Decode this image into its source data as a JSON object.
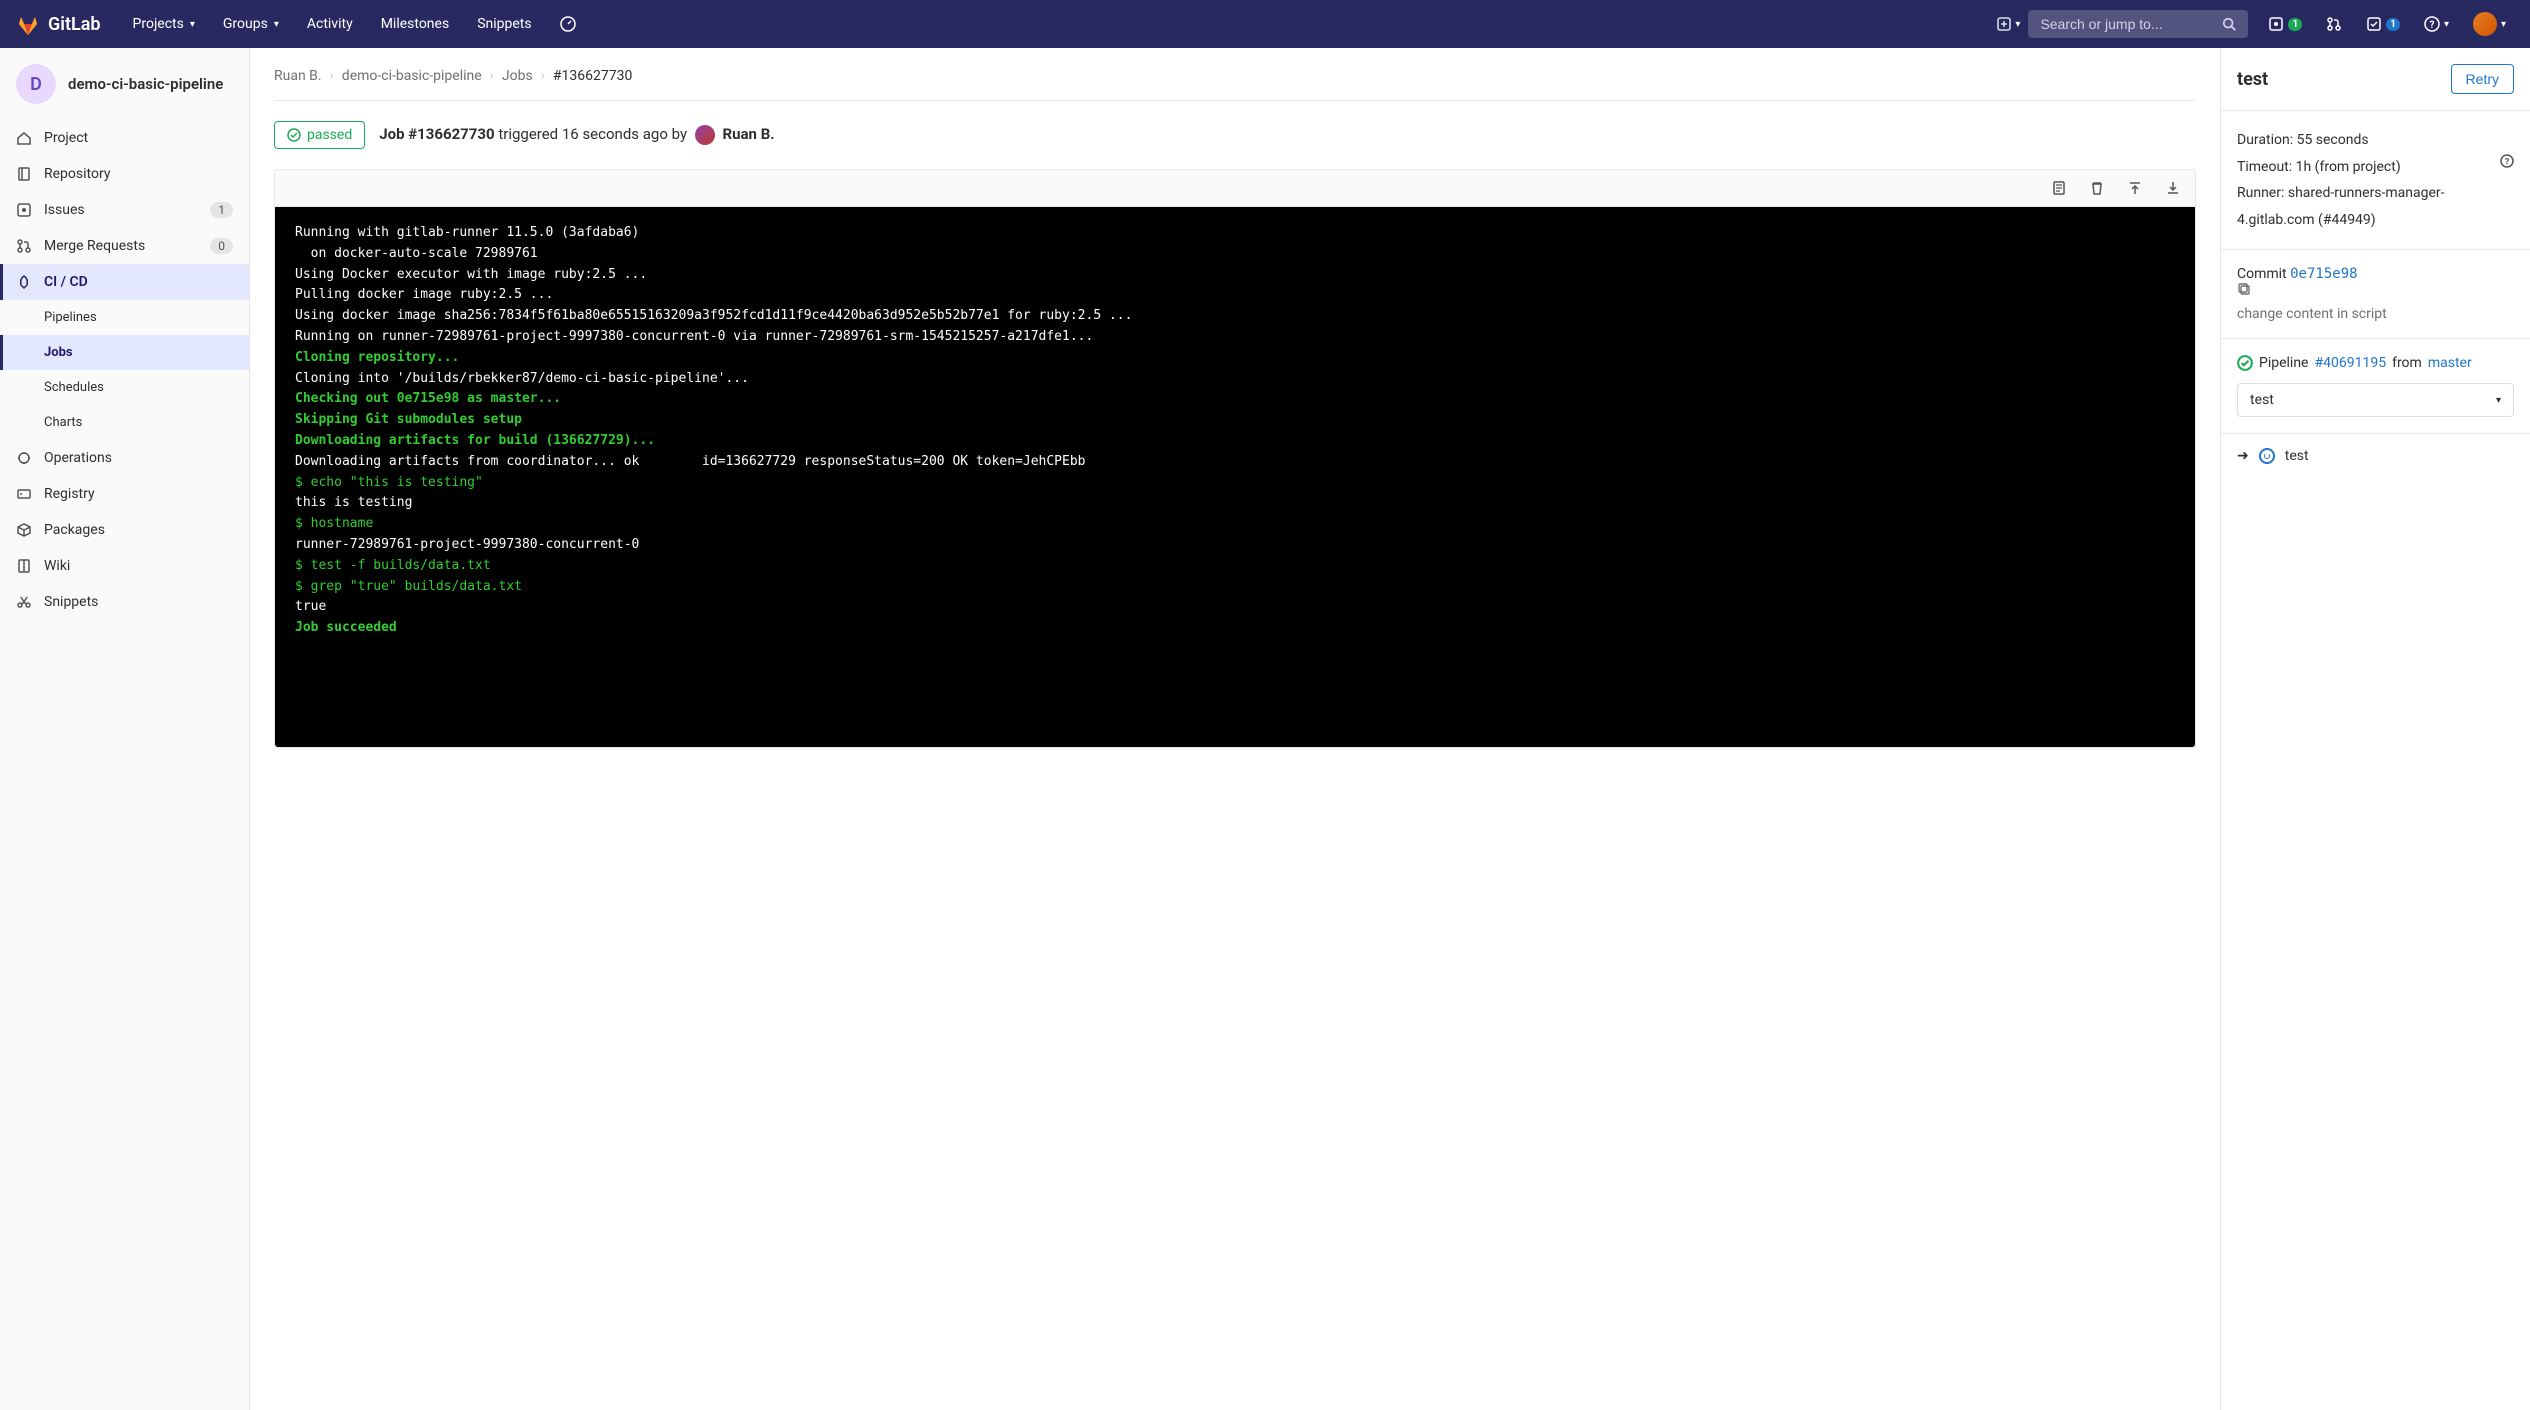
{
  "topnav": {
    "brand": "GitLab",
    "items": [
      "Projects",
      "Groups",
      "Activity",
      "Milestones",
      "Snippets"
    ],
    "search_placeholder": "Search or jump to...",
    "issues_badge": "1",
    "todos_badge": "1"
  },
  "sidebar": {
    "project_initial": "D",
    "project_name": "demo-ci-basic-pipeline",
    "items": [
      {
        "icon": "home",
        "label": "Project"
      },
      {
        "icon": "repo",
        "label": "Repository"
      },
      {
        "icon": "issues",
        "label": "Issues",
        "count": "1"
      },
      {
        "icon": "mr",
        "label": "Merge Requests",
        "count": "0"
      },
      {
        "icon": "rocket",
        "label": "CI / CD",
        "active": true
      },
      {
        "sub": true,
        "label": "Pipelines"
      },
      {
        "sub": true,
        "label": "Jobs",
        "active": true
      },
      {
        "sub": true,
        "label": "Schedules"
      },
      {
        "sub": true,
        "label": "Charts"
      },
      {
        "icon": "ops",
        "label": "Operations"
      },
      {
        "icon": "registry",
        "label": "Registry"
      },
      {
        "icon": "packages",
        "label": "Packages"
      },
      {
        "icon": "wiki",
        "label": "Wiki"
      },
      {
        "icon": "snippets",
        "label": "Snippets"
      }
    ]
  },
  "breadcrumbs": [
    "Ruan B.",
    "demo-ci-basic-pipeline",
    "Jobs",
    "#136627730"
  ],
  "job": {
    "status": "passed",
    "id_label": "Job #136627730",
    "triggered_text": "triggered 16 seconds ago by",
    "author": "Ruan B."
  },
  "log_lines": [
    {
      "t": "Running with gitlab-runner 11.5.0 (3afdaba6)"
    },
    {
      "t": "  on docker-auto-scale 72989761"
    },
    {
      "t": "Using Docker executor with image ruby:2.5 ..."
    },
    {
      "t": "Pulling docker image ruby:2.5 ..."
    },
    {
      "t": "Using docker image sha256:7834f5f61ba80e65515163209a3f952fcd1d11f9ce4420ba63d952e5b52b77e1 for ruby:2.5 ..."
    },
    {
      "t": "Running on runner-72989761-project-9997380-concurrent-0 via runner-72989761-srm-1545215257-a217dfe1..."
    },
    {
      "c": "lg",
      "t": "Cloning repository..."
    },
    {
      "t": "Cloning into '/builds/rbekker87/demo-ci-basic-pipeline'..."
    },
    {
      "c": "lg",
      "t": "Checking out 0e715e98 as master..."
    },
    {
      "c": "lg",
      "t": "Skipping Git submodules setup"
    },
    {
      "c": "lg",
      "t": "Downloading artifacts for build (136627729)..."
    },
    {
      "t": "Downloading artifacts from coordinator... ok        id=136627729 responseStatus=200 OK token=JehCPEbb"
    },
    {
      "c": "lg-cmd",
      "t": "$ echo \"this is testing\""
    },
    {
      "t": "this is testing"
    },
    {
      "c": "lg-cmd",
      "t": "$ hostname"
    },
    {
      "t": "runner-72989761-project-9997380-concurrent-0"
    },
    {
      "c": "lg-cmd",
      "t": "$ test -f builds/data.txt"
    },
    {
      "c": "lg-cmd",
      "t": "$ grep \"true\" builds/data.txt"
    },
    {
      "t": "true"
    },
    {
      "c": "lg",
      "t": "Job succeeded"
    }
  ],
  "right": {
    "title": "test",
    "retry": "Retry",
    "duration_label": "Duration:",
    "duration": "55 seconds",
    "timeout_label": "Timeout:",
    "timeout": "1h (from project)",
    "runner_label": "Runner:",
    "runner": "shared-runners-manager-4.gitlab.com (#44949)",
    "commit_label": "Commit",
    "commit_hash": "0e715e98",
    "commit_msg": "change content in script",
    "pipeline_label": "Pipeline",
    "pipeline_id": "#40691195",
    "pipeline_from": "from",
    "branch": "master",
    "stage_selected": "test",
    "job_name": "test"
  }
}
